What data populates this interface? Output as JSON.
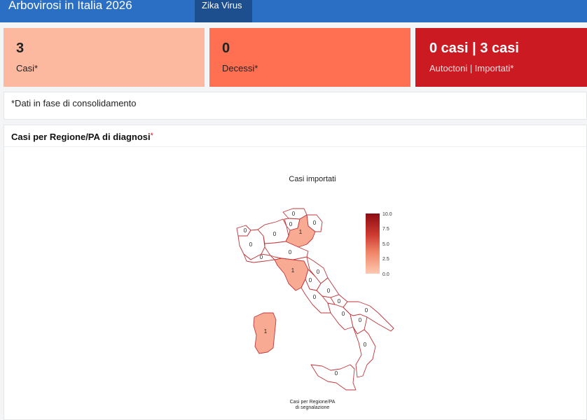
{
  "header": {
    "title": "Arbovirosi in Italia 2026",
    "active_tab": "Zika Virus"
  },
  "kpis": {
    "cases": {
      "value": "3",
      "label": "Casi*",
      "color": "#fdb99f"
    },
    "deaths": {
      "value": "0",
      "label": "Decessi*",
      "color": "#fe7051"
    },
    "origin": {
      "value": "0 casi | 3 casi",
      "label": "Autoctoni | Importati*",
      "color": "#cc1a23"
    }
  },
  "note": "*Dati in fase di consolidamento",
  "map_card": {
    "title": "Casi per Regione/PA di diagnosi",
    "title_star": "*",
    "map_title": "Casi importati",
    "legend_ticks": [
      "10.0",
      "7.5",
      "5.0",
      "2.5",
      "0.0"
    ],
    "caption_line1": "Casi per Regione/PA",
    "caption_line2": "di segnalazione",
    "region_values": {
      "aosta": "0",
      "piemonte": "0",
      "lombardia": "0",
      "trentino": "0",
      "alto_adige": "0",
      "veneto": "1",
      "friuli": "0",
      "liguria": "0",
      "emilia": "0",
      "toscana": "1",
      "umbria": "0",
      "marche": "0",
      "lazio": "0",
      "abruzzo": "0",
      "molise": "0",
      "campania": "0",
      "puglia": "0",
      "basilicata": "0",
      "calabria": "0",
      "sicilia": "0",
      "sardegna": "1"
    }
  }
}
